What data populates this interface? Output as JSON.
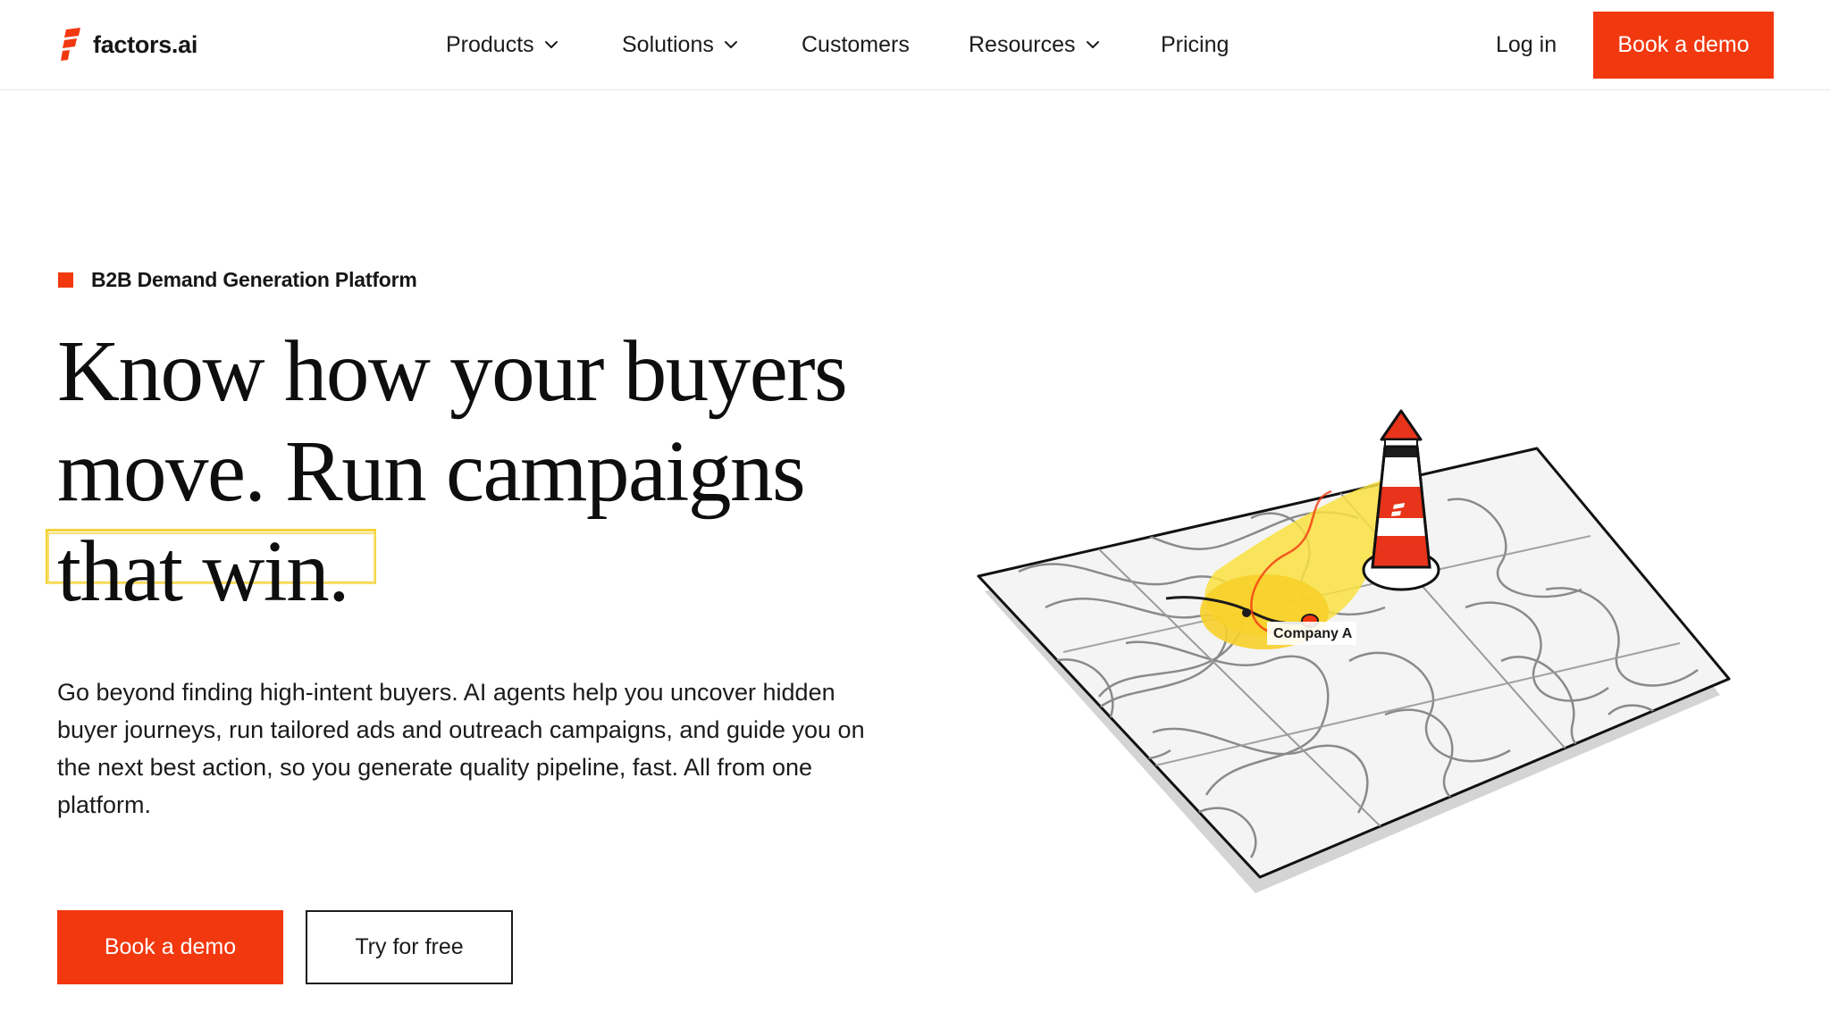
{
  "brand": {
    "name": "factors.ai",
    "accent_color": "#f2380f",
    "highlight_color": "#f4d23a"
  },
  "nav": {
    "items": [
      {
        "label": "Products",
        "has_dropdown": true
      },
      {
        "label": "Solutions",
        "has_dropdown": true
      },
      {
        "label": "Customers",
        "has_dropdown": false
      },
      {
        "label": "Resources",
        "has_dropdown": true
      },
      {
        "label": "Pricing",
        "has_dropdown": false
      }
    ],
    "login_label": "Log in",
    "cta_label": "Book a demo"
  },
  "hero": {
    "eyebrow": "B2B Demand Generation Platform",
    "headline_lines": [
      "Know how your buyers",
      "move. Run campaigns",
      "that win."
    ],
    "subcopy": "Go beyond finding high-intent buyers. AI agents help you uncover hidden buyer journeys, run tailored ads and outreach campaigns, and guide you on the next best action, so you generate quality pipeline, fast. All from one platform.",
    "primary_cta": "Book a demo",
    "secondary_cta": "Try for free"
  },
  "illustration": {
    "label": "Company A",
    "icons": [
      "lighthouse-icon",
      "topographic-map"
    ]
  }
}
